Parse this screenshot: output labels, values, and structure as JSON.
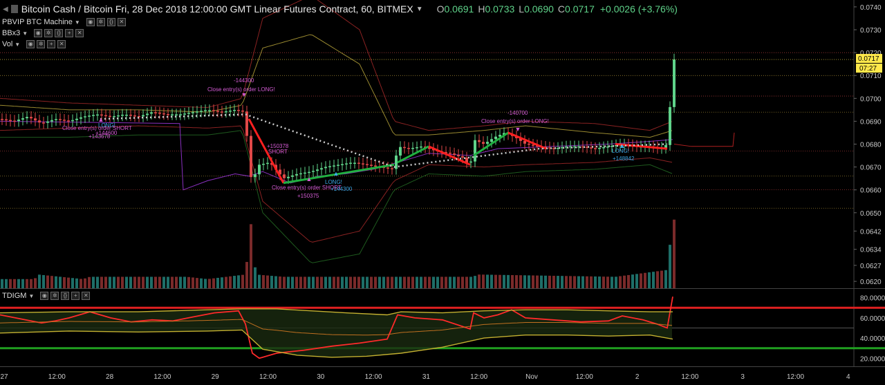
{
  "header": {
    "title": "Bitcoin Cash / Bitcoin Fri, 28 Dec 2018 12:00:00 GMT Linear Futures Contract, 60, BITMEX",
    "o_label": "O",
    "o_value": "0.0691",
    "h_label": "H",
    "h_value": "0.0733",
    "l_label": "L",
    "l_value": "0.0690",
    "c_label": "C",
    "c_value": "0.0717",
    "change": "+0.0026 (+3.76%)"
  },
  "indicators": [
    {
      "name": "PBVIP BTC Machine"
    },
    {
      "name": "BBx3"
    },
    {
      "name": "Vol"
    }
  ],
  "oscillator": {
    "name": "TDIGM"
  },
  "price_axis": {
    "ticks": [
      "0.0740",
      "0.0730",
      "0.0720",
      "0.0710",
      "0.0700",
      "0.0690",
      "0.0680",
      "0.0670",
      "0.0660",
      "0.0650",
      "0.0642",
      "0.0634",
      "0.0627",
      "0.0620"
    ],
    "last_price": "0.0717",
    "countdown": "07:27"
  },
  "osc_axis": {
    "ticks": [
      "80.0000",
      "60.0000",
      "40.0000",
      "20.0000"
    ]
  },
  "time_axis": [
    "27",
    "12:00",
    "28",
    "12:00",
    "29",
    "12:00",
    "30",
    "12:00",
    "31",
    "12:00",
    "Nov",
    "12:00",
    "2",
    "12:00",
    "3",
    "12:00",
    "4"
  ],
  "trade_labels": [
    {
      "text": "-144300"
    },
    {
      "text": "Close entry(s) order LONG!"
    },
    {
      "text": "LONG!"
    },
    {
      "text": "Close entry(s) order SHORT"
    },
    {
      "text": "+144600"
    },
    {
      "text": "+143678"
    },
    {
      "text": "+150378"
    },
    {
      "text": "SHORT"
    },
    {
      "text": "Close entry(s) order SHORT"
    },
    {
      "text": "+150375"
    },
    {
      "text": "LONG!"
    },
    {
      "text": "+144300"
    },
    {
      "text": "-140700"
    },
    {
      "text": "Close entry(s) order LONG!"
    },
    {
      "text": "LONG!"
    },
    {
      "text": "+148842"
    }
  ],
  "colors": {
    "up": "#5fd38a",
    "down": "#e04848",
    "trade_label": "#d65cd6",
    "long_label": "#3aa8e8",
    "last_price_bg": "#ffe84a",
    "osc_upper": "#e02020",
    "osc_lower": "#20a020"
  },
  "chart_data": {
    "type": "candlestick",
    "title": "Bitcoin Cash / Bitcoin Fri, 28 Dec 2018 12:00:00 GMT Linear Futures Contract, 60, BITMEX",
    "price_range": [
      0.0617,
      0.0743
    ],
    "last": {
      "open": 0.0691,
      "high": 0.0733,
      "low": 0.069,
      "close": 0.0717
    },
    "price_path": [
      [
        0,
        0.0691
      ],
      [
        20,
        0.069
      ],
      [
        40,
        0.0692
      ],
      [
        60,
        0.0689
      ],
      [
        80,
        0.0691
      ],
      [
        100,
        0.069
      ],
      [
        120,
        0.0692
      ],
      [
        140,
        0.0693
      ],
      [
        160,
        0.0692
      ],
      [
        180,
        0.0693
      ],
      [
        200,
        0.0692
      ],
      [
        220,
        0.0694
      ],
      [
        240,
        0.0693
      ],
      [
        260,
        0.0693
      ],
      [
        280,
        0.0694
      ],
      [
        300,
        0.0695
      ],
      [
        320,
        0.0694
      ],
      [
        340,
        0.0695
      ],
      [
        355,
        0.0694
      ],
      [
        360,
        0.0668
      ],
      [
        365,
        0.0664
      ],
      [
        375,
        0.0671
      ],
      [
        390,
        0.0672
      ],
      [
        410,
        0.0665
      ],
      [
        430,
        0.0667
      ],
      [
        450,
        0.0668
      ],
      [
        470,
        0.067
      ],
      [
        490,
        0.0671
      ],
      [
        510,
        0.0672
      ],
      [
        530,
        0.0671
      ],
      [
        550,
        0.067
      ],
      [
        570,
        0.0669
      ],
      [
        575,
        0.0679
      ],
      [
        590,
        0.0678
      ],
      [
        610,
        0.0679
      ],
      [
        630,
        0.0677
      ],
      [
        650,
        0.0676
      ],
      [
        670,
        0.0674
      ],
      [
        680,
        0.067
      ],
      [
        685,
        0.0682
      ],
      [
        700,
        0.068
      ],
      [
        715,
        0.0683
      ],
      [
        730,
        0.0685
      ],
      [
        745,
        0.0683
      ],
      [
        760,
        0.068
      ],
      [
        780,
        0.0679
      ],
      [
        800,
        0.0678
      ],
      [
        820,
        0.0679
      ],
      [
        840,
        0.0679
      ],
      [
        860,
        0.0678
      ],
      [
        880,
        0.0679
      ],
      [
        900,
        0.068
      ],
      [
        920,
        0.0679
      ],
      [
        940,
        0.0679
      ],
      [
        955,
        0.0678
      ],
      [
        965,
        0.068
      ],
      [
        968,
        0.0691
      ],
      [
        973,
        0.0717
      ]
    ],
    "volume": [
      [
        0,
        0.0621
      ],
      [
        50,
        0.0621
      ],
      [
        55,
        0.0623
      ],
      [
        120,
        0.0621
      ],
      [
        130,
        0.0622
      ],
      [
        270,
        0.0622
      ],
      [
        300,
        0.0621
      ],
      [
        355,
        0.0623
      ],
      [
        363,
        0.0645
      ],
      [
        370,
        0.0623
      ],
      [
        410,
        0.0622
      ],
      [
        580,
        0.0622
      ],
      [
        650,
        0.0622
      ],
      [
        685,
        0.0622
      ],
      [
        690,
        0.0623
      ],
      [
        890,
        0.0622
      ],
      [
        965,
        0.0625
      ],
      [
        973,
        0.0647
      ]
    ],
    "oscillator_series": [
      {
        "name": "RSI",
        "points": [
          [
            0,
            63
          ],
          [
            30,
            59
          ],
          [
            60,
            55
          ],
          [
            80,
            57
          ],
          [
            100,
            60
          ],
          [
            130,
            66
          ],
          [
            160,
            60
          ],
          [
            190,
            56
          ],
          [
            220,
            58
          ],
          [
            250,
            57
          ],
          [
            280,
            61
          ],
          [
            310,
            65
          ],
          [
            345,
            67
          ],
          [
            355,
            54
          ],
          [
            365,
            25
          ],
          [
            375,
            20
          ],
          [
            400,
            25
          ],
          [
            440,
            28
          ],
          [
            480,
            32
          ],
          [
            520,
            35
          ],
          [
            560,
            39
          ],
          [
            575,
            63
          ],
          [
            600,
            60
          ],
          [
            640,
            58
          ],
          [
            680,
            49
          ],
          [
            685,
            65
          ],
          [
            700,
            60
          ],
          [
            720,
            63
          ],
          [
            740,
            68
          ],
          [
            760,
            60
          ],
          [
            800,
            58
          ],
          [
            840,
            56
          ],
          [
            880,
            57
          ],
          [
            900,
            62
          ],
          [
            930,
            58
          ],
          [
            950,
            54
          ],
          [
            965,
            50
          ],
          [
            973,
            81
          ]
        ]
      },
      {
        "name": "Upper",
        "points": [
          [
            0,
            65
          ],
          [
            100,
            66
          ],
          [
            200,
            66
          ],
          [
            300,
            68
          ],
          [
            350,
            69
          ],
          [
            400,
            69
          ],
          [
            450,
            67
          ],
          [
            500,
            65
          ],
          [
            560,
            63
          ],
          [
            580,
            66
          ],
          [
            640,
            65
          ],
          [
            700,
            67
          ],
          [
            760,
            68
          ],
          [
            820,
            68
          ],
          [
            880,
            67
          ],
          [
            940,
            66
          ],
          [
            973,
            66
          ]
        ]
      },
      {
        "name": "Lower",
        "points": [
          [
            0,
            45
          ],
          [
            100,
            47
          ],
          [
            200,
            46
          ],
          [
            300,
            47
          ],
          [
            350,
            48
          ],
          [
            380,
            29
          ],
          [
            430,
            23
          ],
          [
            480,
            21
          ],
          [
            530,
            22
          ],
          [
            580,
            25
          ],
          [
            640,
            31
          ],
          [
            700,
            40
          ],
          [
            760,
            43
          ],
          [
            820,
            43
          ],
          [
            880,
            42
          ],
          [
            940,
            43
          ],
          [
            973,
            39
          ]
        ]
      }
    ],
    "osc_range": [
      12,
      88
    ],
    "osc_levels": [
      70,
      30
    ]
  }
}
